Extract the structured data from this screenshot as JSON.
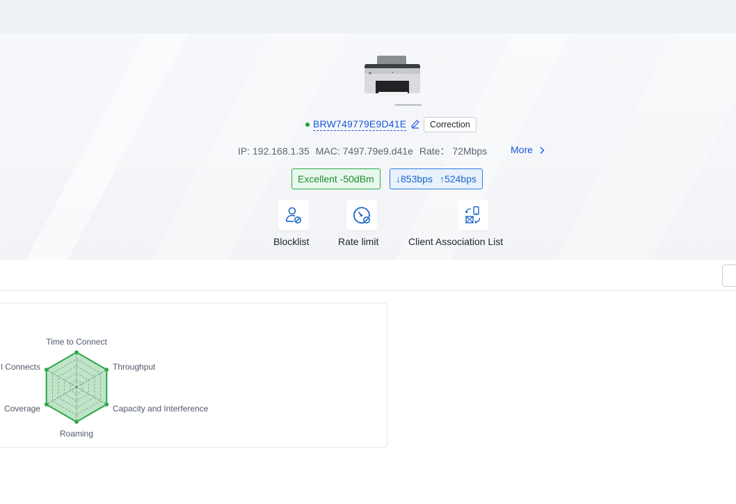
{
  "device": {
    "name": "BRW749779E9D41E",
    "status_color": "#1aa034",
    "correction_label": "Correction",
    "ip": "IP: 192.168.1.35",
    "mac": "MAC: 7497.79e9.d41e",
    "rate": "Rate： 72Mbps",
    "more_label": "More",
    "signal": "Excellent -50dBm",
    "down_rate": "↓853bps",
    "up_rate": "↑524bps"
  },
  "actions": [
    {
      "label": "Blocklist",
      "icon": "user-block-icon"
    },
    {
      "label": "Rate limit",
      "icon": "speed-limit-icon"
    },
    {
      "label": "Client Association List",
      "icon": "association-icon"
    }
  ],
  "radar": {
    "labels": {
      "top": "Time to Connect",
      "top_right": "Throughput",
      "bottom_right": "Capacity and Interference",
      "bottom": "Roaming",
      "bottom_left": "Coverage",
      "top_left": "l Connects"
    },
    "values": [
      1,
      1,
      1,
      1,
      1,
      1
    ],
    "color": "#2aa745"
  },
  "colors": {
    "accent": "#1a56db",
    "good": "#2aa745",
    "rate": "#2b7de0"
  }
}
